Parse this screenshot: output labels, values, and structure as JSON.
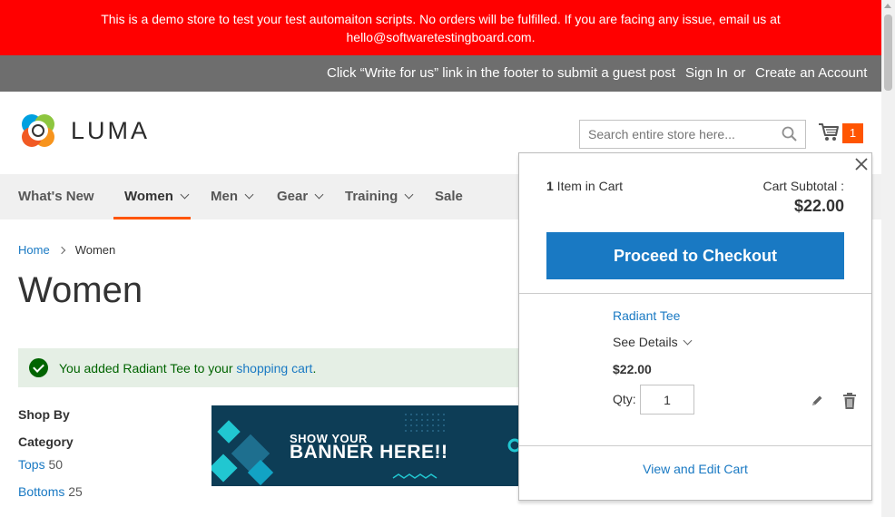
{
  "demo_banner": {
    "line1": "This is a demo store to test your test automaiton scripts. No orders will be fulfilled. If you are facing any issue, email us at",
    "line2": "hello@softwaretestingboard.com."
  },
  "header_panel": {
    "write_for_us": "Click “Write for us” link in the footer to submit a guest post",
    "sign_in": "Sign In",
    "or": "or",
    "create_account": "Create an Account"
  },
  "logo": {
    "text": "LUMA"
  },
  "search": {
    "placeholder": "Search entire store here..."
  },
  "cart": {
    "count": "1"
  },
  "nav": {
    "items": [
      {
        "label": "What's New",
        "dropdown": false
      },
      {
        "label": "Women",
        "dropdown": true,
        "active": true
      },
      {
        "label": "Men",
        "dropdown": true
      },
      {
        "label": "Gear",
        "dropdown": true
      },
      {
        "label": "Training",
        "dropdown": true
      },
      {
        "label": "Sale",
        "dropdown": false
      }
    ]
  },
  "breadcrumb": {
    "home": "Home",
    "current": "Women"
  },
  "page_title": "Women",
  "message": {
    "prefix": "You added Radiant Tee to your ",
    "link": "shopping cart",
    "suffix": "."
  },
  "sidebar": {
    "shop_by": "Shop By",
    "category": "Category",
    "items": [
      {
        "label": "Tops",
        "count": "50"
      },
      {
        "label": "Bottoms",
        "count": "25"
      }
    ]
  },
  "banner": {
    "line1": "SHOW YOUR",
    "line2": "BANNER HERE!!"
  },
  "minicart": {
    "count_num": "1",
    "count_text": " Item in Cart",
    "subtotal_label": "Cart Subtotal :",
    "subtotal_value": "$22.00",
    "checkout_label": "Proceed to Checkout",
    "item": {
      "name": "Radiant Tee",
      "see_details": "See Details",
      "price": "$22.00",
      "qty_label": "Qty:",
      "qty": "1"
    },
    "view_edit": "View and Edit Cart"
  },
  "colors": {
    "demo_banner_bg": "#ff0000",
    "header_bg": "#6e6e6e",
    "accent": "#ff5501",
    "link": "#1979c3",
    "button": "#1979c3",
    "success_bg": "#e5efe5",
    "success_text": "#006400"
  }
}
